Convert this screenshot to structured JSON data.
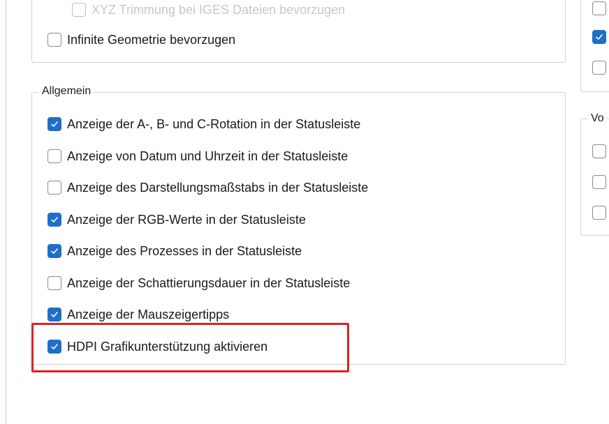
{
  "top_group": {
    "partial_item_label": "XYZ Trimmung bei IGES Dateien bevorzugen",
    "items": [
      {
        "label": "Infinite Geometrie bevorzugen",
        "checked": false
      }
    ]
  },
  "allgemein": {
    "title": "Allgemein",
    "items": [
      {
        "label": "Anzeige der A-, B- und C-Rotation in der Statusleiste",
        "checked": true
      },
      {
        "label": "Anzeige von Datum und Uhrzeit in der Statusleiste",
        "checked": false
      },
      {
        "label": "Anzeige des Darstellungsmaßstabs in der Statusleiste",
        "checked": false
      },
      {
        "label": "Anzeige der RGB-Werte in der Statusleiste",
        "checked": true
      },
      {
        "label": "Anzeige des Prozesses in der Statusleiste",
        "checked": true
      },
      {
        "label": "Anzeige der Schattierungsdauer in der Statusleiste",
        "checked": false
      },
      {
        "label": "Anzeige der Mauszeigertipps",
        "checked": true
      },
      {
        "label": "HDPI Grafikunterstützung aktivieren",
        "checked": true,
        "highlighted": true
      }
    ]
  },
  "right_top_group": {
    "checkboxes": [
      false,
      true,
      false
    ]
  },
  "right_bottom_group": {
    "title_partial": "Vo",
    "checkboxes": [
      false,
      false,
      false
    ]
  },
  "colors": {
    "accent": "#1f6fc9",
    "highlight_border": "#e02020"
  }
}
